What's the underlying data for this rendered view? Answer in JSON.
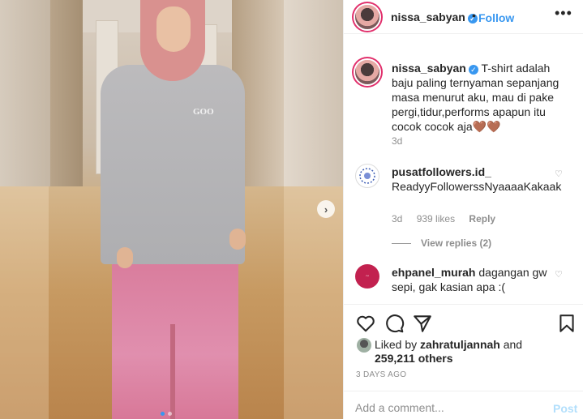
{
  "header": {
    "username": "nissa_sabyan",
    "follow_label": "Follow",
    "separator": "•",
    "more_label": "•••"
  },
  "caption": {
    "username": "nissa_sabyan",
    "text": "T-shirt adalah baju paling ternyaman sepanjang masa menurut aku, mau di pake pergi,tidur,performs apapun itu cocok cocok aja🤎🤎",
    "time": "3d"
  },
  "comments": [
    {
      "username": "pusatfollowers.id_",
      "text": "ReadyyFollowerssNyaaaaKakaak",
      "time": "3d",
      "likes": "939 likes",
      "reply_label": "Reply",
      "view_replies": "View replies (2)"
    },
    {
      "username": "ehpanel_murah",
      "text": "dagangan gw sepi, gak kasian apa :("
    }
  ],
  "actions": {
    "like_icon": "heart-icon",
    "comment_icon": "comment-icon",
    "share_icon": "paper-plane-icon",
    "save_icon": "bookmark-icon"
  },
  "likes": {
    "prefix": "Liked by ",
    "user": "zahratuljannah",
    "and": " and",
    "count": "259,211 others"
  },
  "post_date": "3 DAYS AGO",
  "add_comment": {
    "placeholder": "Add a comment...",
    "post_label": "Post"
  },
  "carousel": {
    "next_label": "›",
    "total": 2,
    "current": 1
  },
  "photo": {
    "shirt_print": "GOO"
  },
  "colors": {
    "accent": "#3897f0",
    "post_disabled": "#b2dffc",
    "muted": "#8e8e8e"
  }
}
